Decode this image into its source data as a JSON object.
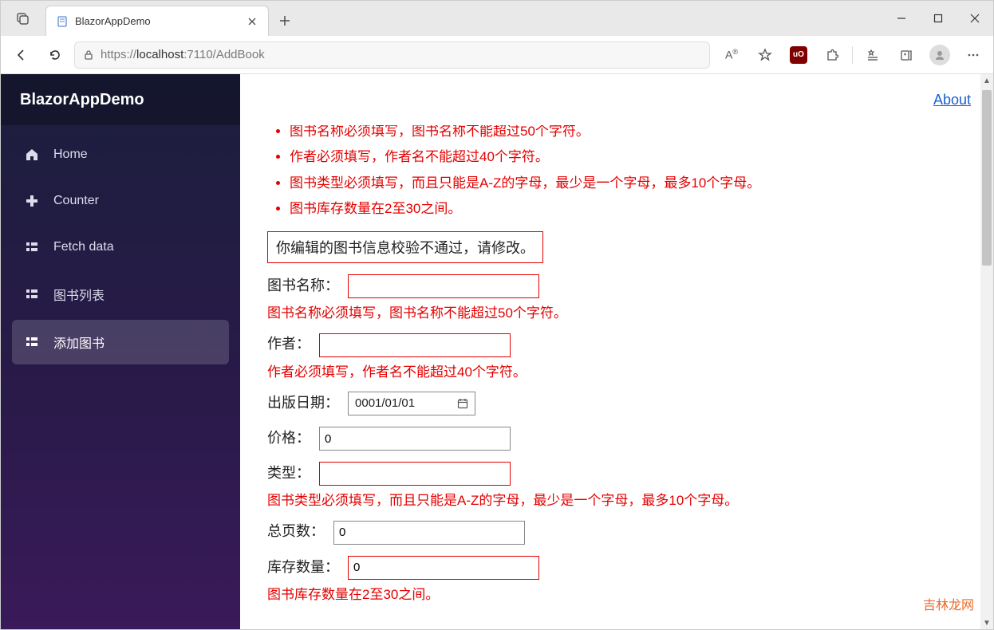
{
  "window": {
    "tab_title": "BlazorAppDemo",
    "url_prefix": "https://",
    "url_host": "localhost",
    "url_port_path": ":7110/AddBook"
  },
  "sidebar": {
    "brand": "BlazorAppDemo",
    "items": [
      {
        "label": "Home"
      },
      {
        "label": "Counter"
      },
      {
        "label": "Fetch data"
      },
      {
        "label": "图书列表"
      },
      {
        "label": "添加图书"
      }
    ]
  },
  "topbar": {
    "about": "About"
  },
  "validation": {
    "summary": [
      "图书名称必须填写，图书名称不能超过50个字符。",
      "作者必须填写，作者名不能超过40个字符。",
      "图书类型必须填写，而且只能是A-Z的字母，最少是一个字母，最多10个字母。",
      "图书库存数量在2至30之间。"
    ],
    "alert": "你编辑的图书信息校验不通过，请修改。"
  },
  "form": {
    "name": {
      "label": "图书名称：",
      "value": "",
      "error": "图书名称必须填写，图书名称不能超过50个字符。"
    },
    "author": {
      "label": "作者：",
      "value": "",
      "error": "作者必须填写，作者名不能超过40个字符。"
    },
    "pubdate": {
      "label": "出版日期：",
      "value": "0001/01/01"
    },
    "price": {
      "label": "价格：",
      "value": "0"
    },
    "type": {
      "label": "类型：",
      "value": "",
      "error": "图书类型必须填写，而且只能是A-Z的字母，最少是一个字母，最多10个字母。"
    },
    "pages": {
      "label": "总页数：",
      "value": "0"
    },
    "stock": {
      "label": "库存数量：",
      "value": "0",
      "error": "图书库存数量在2至30之间。"
    }
  },
  "watermark": "吉林龙网"
}
